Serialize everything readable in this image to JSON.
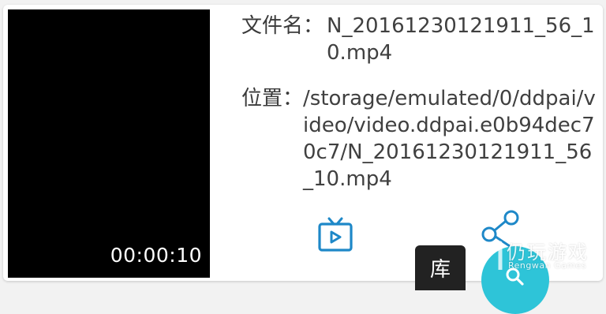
{
  "video": {
    "duration": "00:00:10"
  },
  "details": {
    "name_label": "文件名：",
    "name_value": "N_20161230121911_56_10.mp4",
    "location_label": "位置：",
    "location_value": "/storage/emulated/0/ddpai/video/video.ddpai.e0b94dec70c7/N_20161230121911_56_10.mp4"
  },
  "actions": {
    "play_icon": "tv-play-icon",
    "share_icon": "share-icon"
  },
  "bottom": {
    "library_tab": "库",
    "search_icon": "search-icon"
  },
  "watermark": {
    "text": "仍玩游戏",
    "subtext": "Rengwan Games"
  },
  "colors": {
    "accent": "#1e88c8",
    "fab": "#2ec4d8",
    "thumbnail_bg": "#000000"
  }
}
